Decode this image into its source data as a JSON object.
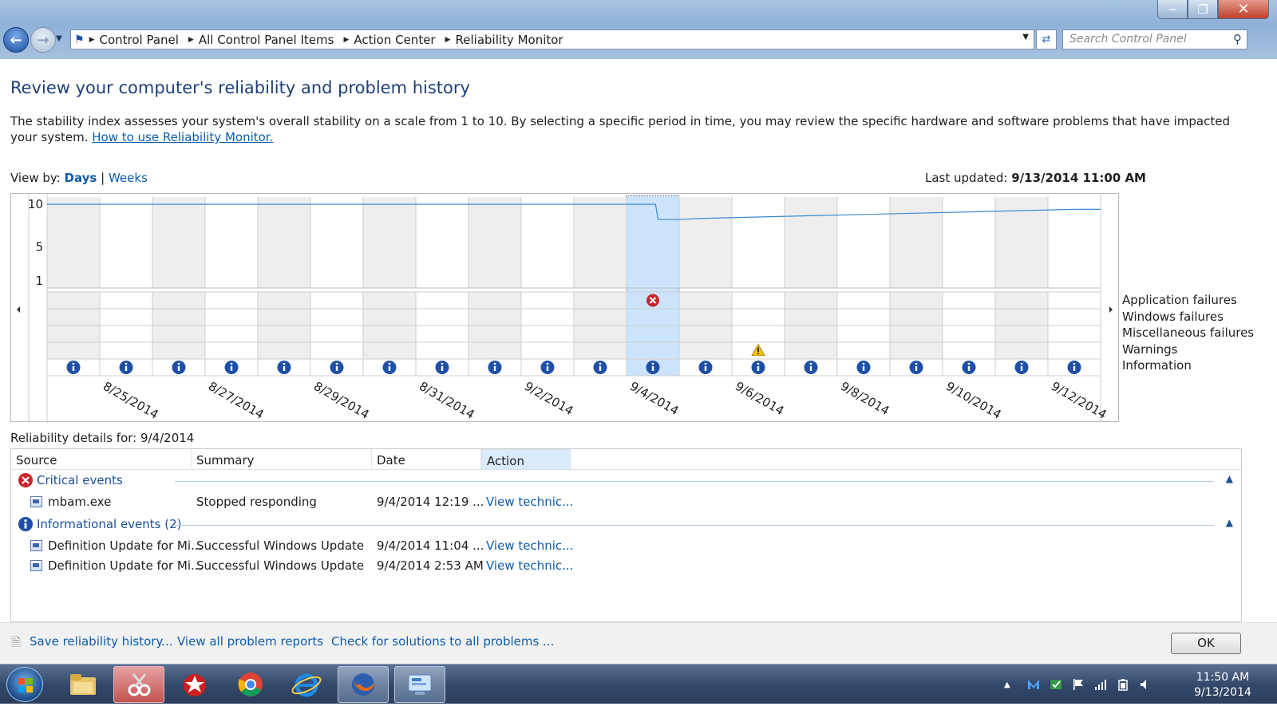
{
  "window": {
    "breadcrumbs": [
      "Control Panel",
      "All Control Panel Items",
      "Action Center",
      "Reliability Monitor"
    ],
    "search_placeholder": "Search Control Panel"
  },
  "page": {
    "title": "Review your computer's reliability and problem history",
    "intro_text": "The stability index assesses your system's overall stability on a scale from 1 to 10. By selecting a specific period in time, you may review the specific hardware and software problems that have impacted your system. ",
    "intro_link": "How to use Reliability Monitor.",
    "view_by_label": "View by:",
    "view_days": "Days",
    "view_sep": "|",
    "view_weeks": "Weeks",
    "last_updated_label": "Last updated:",
    "last_updated_value": "9/13/2014 11:00 AM"
  },
  "chart_data": {
    "type": "line",
    "y_ticks": [
      "10",
      "5",
      "1"
    ],
    "ylim": [
      1,
      10
    ],
    "dates": [
      "8/24/2014",
      "8/25/2014",
      "8/26/2014",
      "8/27/2014",
      "8/28/2014",
      "8/29/2014",
      "8/30/2014",
      "8/31/2014",
      "9/1/2014",
      "9/2/2014",
      "9/3/2014",
      "9/4/2014",
      "9/5/2014",
      "9/6/2014",
      "9/7/2014",
      "9/8/2014",
      "9/9/2014",
      "9/10/2014",
      "9/11/2014",
      "9/12/2014"
    ],
    "x_tick_labels": [
      "8/25/2014",
      "8/27/2014",
      "8/29/2014",
      "8/31/2014",
      "9/2/2014",
      "9/4/2014",
      "9/6/2014",
      "9/8/2014",
      "9/10/2014",
      "9/12/2014"
    ],
    "stability_index": [
      10,
      10,
      10,
      10,
      10,
      10,
      10,
      10,
      10,
      10,
      10,
      8.2,
      8.35,
      8.5,
      8.65,
      8.8,
      8.95,
      9.1,
      9.25,
      9.4
    ],
    "selected_date": "9/4/2014",
    "event_rows": [
      "Application failures",
      "Windows failures",
      "Miscellaneous failures",
      "Warnings",
      "Information"
    ],
    "events": {
      "application_failures": [
        "9/4/2014"
      ],
      "windows_failures": [],
      "miscellaneous_failures": [],
      "warnings": [
        "9/6/2014"
      ],
      "information": [
        "8/24/2014",
        "8/25/2014",
        "8/26/2014",
        "8/27/2014",
        "8/28/2014",
        "8/29/2014",
        "8/30/2014",
        "8/31/2014",
        "9/1/2014",
        "9/2/2014",
        "9/3/2014",
        "9/4/2014",
        "9/5/2014",
        "9/6/2014",
        "9/7/2014",
        "9/8/2014",
        "9/9/2014",
        "9/10/2014",
        "9/11/2014",
        "9/12/2014"
      ]
    },
    "colors": {
      "line": "#3c8ad0",
      "selected": "#cce4fb",
      "shaded_column": "#eeeeee",
      "info": "#1e4fa8",
      "error": "#c8252b",
      "warning": "#f2c20f"
    }
  },
  "details": {
    "title": "Reliability details for: 9/4/2014",
    "columns": [
      "Source",
      "Summary",
      "Date",
      "Action"
    ],
    "groups": [
      {
        "label": "Critical events",
        "icon": "critical-icon",
        "rows": [
          {
            "source": "mbam.exe",
            "summary": "Stopped responding",
            "date": "9/4/2014 12:19 ...",
            "action": "View  technic..."
          }
        ]
      },
      {
        "label": "Informational events (2)",
        "icon": "info-icon",
        "rows": [
          {
            "source": "Definition Update for Mi...",
            "summary": "Successful Windows Update",
            "date": "9/4/2014 11:04 ...",
            "action": "View  technic..."
          },
          {
            "source": "Definition Update for Mi...",
            "summary": "Successful Windows Update",
            "date": "9/4/2014 2:53 AM",
            "action": "View  technic..."
          }
        ]
      }
    ]
  },
  "footer": {
    "save_history": "Save reliability history...",
    "view_reports": "View all problem reports",
    "check_solutions": "Check for solutions to all problems ...",
    "ok": "OK"
  },
  "taskbar": {
    "apps": [
      "windows-explorer-icon",
      "snipping-tool-icon",
      "pokerstars-icon",
      "chrome-icon",
      "internet-explorer-icon",
      "firefox-icon",
      "control-panel-icon"
    ],
    "time": "11:50 AM",
    "date": "9/13/2014"
  }
}
